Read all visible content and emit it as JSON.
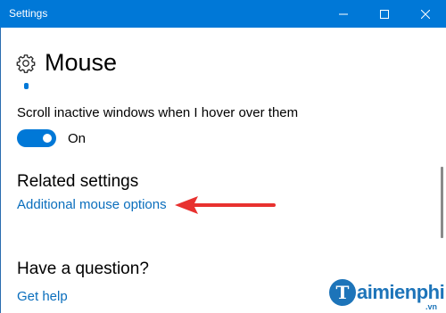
{
  "window": {
    "title": "Settings",
    "controls": {
      "minimize": "minimize",
      "maximize": "maximize",
      "close": "close"
    },
    "accent_color": "#0078d7"
  },
  "page": {
    "title": "Mouse",
    "icon": "gear-icon"
  },
  "scroll_inactive": {
    "label": "Scroll inactive windows when I hover over them",
    "state_label": "On",
    "enabled": true
  },
  "related_settings": {
    "heading": "Related settings",
    "link": "Additional mouse options"
  },
  "question": {
    "heading": "Have a question?",
    "link": "Get help"
  },
  "annotation": {
    "arrow_color": "#e8312f",
    "points_to": "Additional mouse options"
  },
  "watermark": {
    "logo_letter": "T",
    "text": "aimienphi",
    "suffix": ".vn"
  },
  "colors": {
    "link": "#0a6ebd",
    "toggle_on": "#0078d7"
  }
}
